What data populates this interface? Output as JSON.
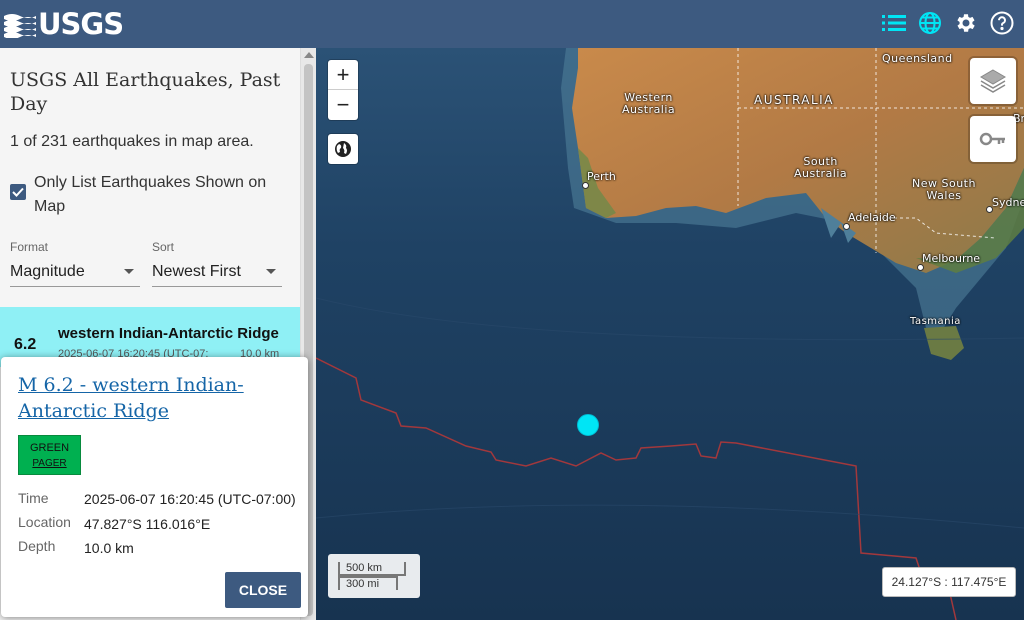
{
  "header": {
    "logo_text": "USGS",
    "icons": [
      "list-icon",
      "globe-icon",
      "gear-icon",
      "help-icon"
    ],
    "bg_color": "#3d5a80",
    "active_color": "#00e5f5"
  },
  "sidebar": {
    "title": "USGS All Earthquakes, Past Day",
    "count_text": "1 of 231 earthquakes in map area.",
    "only_list_label": "Only List Earthquakes Shown on Map",
    "only_list_checked": true,
    "format": {
      "label": "Format",
      "value": "Magnitude"
    },
    "sort": {
      "label": "Sort",
      "value": "Newest First"
    },
    "list": [
      {
        "magnitude": "6.2",
        "place": "western Indian-Antarctic Ridge",
        "time": "2025-06-07 16:20:45 (UTC-07:",
        "depth": "10.0 km",
        "highlight_color": "#8ff0f5"
      }
    ]
  },
  "map": {
    "labels": {
      "western_australia": "Western\nAustralia",
      "australia": "AUSTRALIA",
      "queensland": "Queensland",
      "south_australia": "South\nAustralia",
      "new_south_wales": "New South\nWales",
      "tasmania": "Tasmania"
    },
    "cities": {
      "perth": "Perth",
      "adelaide": "Adelaide",
      "melbourne": "Melbourne",
      "sydney": "Sydne",
      "brisbane": "Br"
    },
    "scale": {
      "km": "500 km",
      "mi": "300 mi"
    },
    "coords": "24.127°S : 117.475°E",
    "zoom_in": "+",
    "zoom_out": "−"
  },
  "popup": {
    "title": "M 6.2 - western Indian-Antarctic Ridge",
    "pager_line1": "GREEN",
    "pager_line2": "PAGER",
    "pager_color": "#00b050",
    "time_label": "Time",
    "time_value": "2025-06-07 16:20:45 (UTC-07:00)",
    "location_label": "Location",
    "location_value": "47.827°S 116.016°E",
    "depth_label": "Depth",
    "depth_value": "10.0 km",
    "close_label": "CLOSE"
  }
}
